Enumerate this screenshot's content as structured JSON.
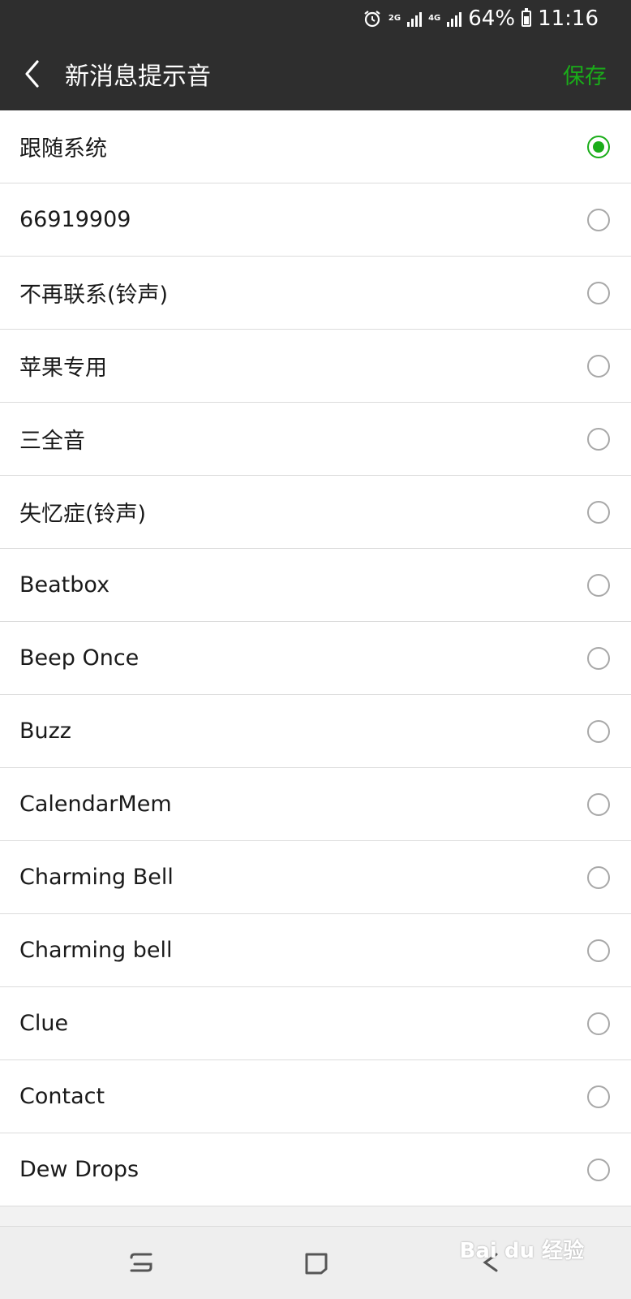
{
  "status_bar": {
    "network_2g": "2G",
    "network_4g": "4G",
    "battery": "64%",
    "time": "11:16"
  },
  "header": {
    "title": "新消息提示音",
    "save_label": "保存"
  },
  "accent_color": "#1aad19",
  "ringtones": {
    "selected_index": 0,
    "items": [
      {
        "label": "跟随系统",
        "selected": true
      },
      {
        "label": "66919909",
        "selected": false
      },
      {
        "label": "不再联系(铃声)",
        "selected": false
      },
      {
        "label": "苹果专用",
        "selected": false
      },
      {
        "label": "三全音",
        "selected": false
      },
      {
        "label": "失忆症(铃声)",
        "selected": false
      },
      {
        "label": "Beatbox",
        "selected": false
      },
      {
        "label": "Beep Once",
        "selected": false
      },
      {
        "label": "Buzz",
        "selected": false
      },
      {
        "label": "CalendarMem",
        "selected": false
      },
      {
        "label": "Charming Bell",
        "selected": false
      },
      {
        "label": "Charming bell",
        "selected": false
      },
      {
        "label": "Clue",
        "selected": false
      },
      {
        "label": "Contact",
        "selected": false
      },
      {
        "label": "Dew Drops",
        "selected": false
      }
    ]
  },
  "watermark": {
    "text": "Bai du 经验"
  }
}
